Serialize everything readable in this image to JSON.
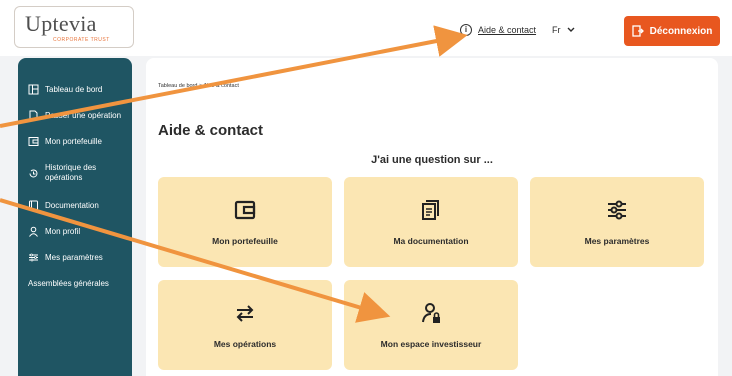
{
  "header": {
    "logo_text": "Uptevia",
    "logo_subtext": "CORPORATE TRUST",
    "help_link": "Aide & contact",
    "language": "Fr",
    "logout": "Déconnexion"
  },
  "sidebar": {
    "items": [
      {
        "label": "Tableau de bord",
        "icon": "dashboard-icon"
      },
      {
        "label": "Passer une opération",
        "icon": "document-icon"
      },
      {
        "label": "Mon portefeuille",
        "icon": "wallet-icon"
      },
      {
        "label": "Historique des opérations",
        "icon": "history-icon"
      },
      {
        "label": "Documentation",
        "icon": "book-icon"
      },
      {
        "label": "Mon profil",
        "icon": "user-icon"
      },
      {
        "label": "Mes paramètres",
        "icon": "sliders-icon"
      },
      {
        "label": "Assemblées générales",
        "icon": ""
      }
    ]
  },
  "main": {
    "breadcrumb": "Tableau de bord > Aide & contact",
    "title": "Aide & contact",
    "question": "J'ai une question sur ...",
    "tiles": [
      {
        "label": "Mon portefeuille",
        "icon": "wallet-icon"
      },
      {
        "label": "Ma documentation",
        "icon": "documentation-icon"
      },
      {
        "label": "Mes paramètres",
        "icon": "sliders-icon"
      },
      {
        "label": "Mes opérations",
        "icon": "transfer-arrows-icon"
      },
      {
        "label": "Mon espace investisseur",
        "icon": "investor-lock-icon"
      }
    ]
  },
  "colors": {
    "sidebar": "#1f5563",
    "accent": "#e8571f",
    "tile": "#fbe6b3",
    "annotation_arrow": "#f0943f"
  }
}
